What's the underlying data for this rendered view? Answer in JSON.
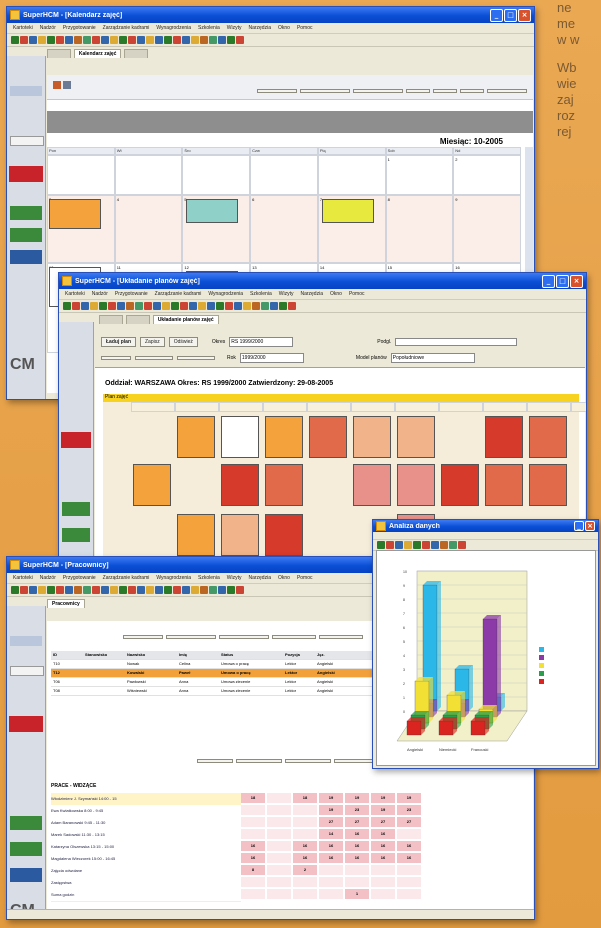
{
  "side_text": {
    "p1": "ne\nme\nw w",
    "p2": "Wb\nwie\nzaj\nroz\nrej"
  },
  "windows": {
    "w1": {
      "title": "SuperHCM - [Kalendarz zajęć]",
      "active_tab": "Kalendarz zajęć",
      "month_label": "Miesiąc: 10-2005"
    },
    "w2": {
      "title": "SuperHCM - [Układanie planów zajęć]",
      "active_tab": "Układanie planów zajęć",
      "plan_title": "Oddział: WARSZAWA   Okres: RS 1999/2000   Zatwierdzony: 29-08-2005",
      "plan_header": "Plan zajęć",
      "btn_load": "Ładuj plan",
      "btn_save": "Zapisz",
      "btn_close": "Odśwież",
      "label_okres": "Okres",
      "value_okres": "RS 1999/2000",
      "label_rok": "Rok",
      "value_rok": "1999/2000",
      "label_model": "Model planów",
      "value_model": "Popołudniowe",
      "label_podgl": "Podgl."
    },
    "w3": {
      "title": "SuperHCM - [Pracownicy]",
      "active_tab": "Pracownicy",
      "grid_title": "PRACE - WIDZĄCE"
    },
    "w4": {
      "title": "Analiza danych"
    }
  },
  "menu_items": [
    "Kartoteki",
    "Nadzór",
    "Przygotowanie",
    "Zarządzanie kadrami",
    "Wynagrodzenia",
    "Szkolenia",
    "Wizyty",
    "Narzędzia",
    "Okno",
    "Pomoc"
  ],
  "w1_days": [
    "Pon",
    "Wt",
    "Śro",
    "Czw",
    "Pią",
    "Sob",
    "Nd"
  ],
  "w1_dates_row1": [
    "",
    "",
    "",
    "",
    "",
    "1",
    "2"
  ],
  "w1_dates_row2": [
    "3",
    "4",
    "5",
    "6",
    "7",
    "8",
    "9"
  ],
  "w1_dates_row3": [
    "10",
    "11",
    "12",
    "13",
    "14",
    "15",
    "16"
  ],
  "w3_table": {
    "headers": [
      "ID",
      "Stanowisko",
      "Nazwisko",
      "Imię",
      "Status",
      "Pozycja",
      "Jęz."
    ],
    "rows": [
      [
        "T10",
        "",
        "Nowak",
        "Celina",
        "Umowa o pracę",
        "Lektor",
        "Angielski"
      ],
      [
        "T12",
        "",
        "Kowalski",
        "Paweł",
        "Umowa o pracę",
        "Lektor",
        "Angielski"
      ],
      [
        "T06",
        "",
        "Pawłowski",
        "Anna",
        "Umowa zlecenie",
        "Lektor",
        "Angielski"
      ],
      [
        "T08",
        "",
        "Wiśniewski",
        "Anna",
        "Umowa zlecenie",
        "Lektor",
        "Angielski"
      ]
    ]
  },
  "w3_grid_rows": [
    {
      "label": "Włodzimierz J. Szymański 14:00 - 15",
      "v": [
        "18",
        "",
        "18",
        "19",
        "19",
        "19",
        "19"
      ]
    },
    {
      "label": "Ewa Kwiatkowska 8:00 - 9:45",
      "v": [
        "",
        "",
        "",
        "19",
        "23",
        "19",
        "23"
      ]
    },
    {
      "label": "Adam Baranowski 9:45 - 11:30",
      "v": [
        "",
        "",
        "",
        "27",
        "27",
        "27",
        "27"
      ]
    },
    {
      "label": "Marek Sadowski 11:30 - 13:15",
      "v": [
        "",
        "",
        "",
        "14",
        "16",
        "16",
        ""
      ]
    },
    {
      "label": "Katarzyna Olszewska 13:15 - 15:00",
      "v": [
        "16",
        "",
        "16",
        "16",
        "16",
        "16",
        "16"
      ]
    },
    {
      "label": "Magdalena Wieczorek 15:00 - 16:45",
      "v": [
        "16",
        "",
        "16",
        "16",
        "16",
        "16",
        "16"
      ]
    },
    {
      "label": "Zajęcia odwołane",
      "v": [
        "8",
        "",
        "2",
        "",
        "",
        "",
        ""
      ]
    },
    {
      "label": "Zastępstwa",
      "v": [
        "",
        "",
        "",
        "",
        "",
        "",
        ""
      ]
    },
    {
      "label": "Suma godzin",
      "v": [
        "",
        "",
        "",
        "",
        "1",
        "",
        ""
      ]
    }
  ],
  "chart_data": {
    "type": "bar",
    "title": "",
    "categories": [
      "Angielski",
      "Niemiecki",
      "Francuski"
    ],
    "series": [
      {
        "name": "",
        "color": "#2bb7e8",
        "values": [
          9,
          3,
          1
        ]
      },
      {
        "name": "",
        "color": "#8b3aa8",
        "values": [
          1,
          1,
          7
        ]
      },
      {
        "name": "",
        "color": "#f2e035",
        "values": [
          3,
          2,
          1
        ]
      },
      {
        "name": "",
        "color": "#2a9e4a",
        "values": [
          1,
          1,
          1
        ]
      },
      {
        "name": "",
        "color": "#d9241f",
        "values": [
          1,
          1,
          1
        ]
      }
    ]
  },
  "colors": {
    "accent": "#0a4fd6",
    "brand_red": "#c8232a",
    "event_orange": "#f4a23c",
    "event_red": "#d63a2a",
    "event_teal": "#8fd1c8",
    "event_yellow": "#e7e93f"
  }
}
